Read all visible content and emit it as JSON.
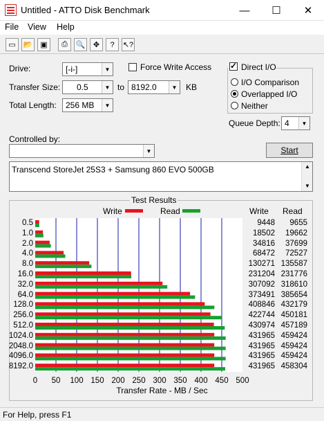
{
  "window": {
    "title": "Untitled - ATTO Disk Benchmark",
    "min": "—",
    "max": "☐",
    "close": "✕"
  },
  "menu": [
    "File",
    "View",
    "Help"
  ],
  "toolbar": [
    "new",
    "open",
    "save",
    "print",
    "print-preview",
    "move",
    "help",
    "context-help"
  ],
  "form": {
    "drive_label": "Drive:",
    "drive_value": "[-i-]",
    "transfer_size_label": "Transfer Size:",
    "ts_from": "0.5",
    "to_label": "to",
    "ts_to": "8192.0",
    "kb_label": "KB",
    "total_length_label": "Total Length:",
    "total_length_value": "256 MB",
    "force_write_label": "Force Write Access",
    "direct_io_label": "Direct I/O",
    "io_comparison_label": "I/O Comparison",
    "overlapped_io_label": "Overlapped I/O",
    "neither_label": "Neither",
    "queue_depth_label": "Queue Depth:",
    "queue_depth_value": "4",
    "controlled_by_label": "Controlled by:",
    "start_label": "Start",
    "description": "Transcend StoreJet 25S3 + Samsung 860 EVO 500GB"
  },
  "results": {
    "title": "Test Results",
    "write_legend": "Write",
    "read_legend": "Read",
    "write_col": "Write",
    "read_col": "Read",
    "xlabel": "Transfer Rate - MB / Sec"
  },
  "colors": {
    "write": "#e8141e",
    "read": "#16a030",
    "grid": "#1a1aa8"
  },
  "chart_data": {
    "type": "bar",
    "orientation": "horizontal",
    "categories": [
      "0.5",
      "1.0",
      "2.0",
      "4.0",
      "8.0",
      "16.0",
      "32.0",
      "64.0",
      "128.0",
      "256.0",
      "512.0",
      "1024.0",
      "2048.0",
      "4096.0",
      "8192.0"
    ],
    "series": [
      {
        "name": "Write",
        "values": [
          9448,
          18502,
          34816,
          68472,
          130271,
          231204,
          307092,
          373491,
          408846,
          422744,
          430974,
          431965,
          431965,
          431965,
          431965
        ]
      },
      {
        "name": "Read",
        "values": [
          9655,
          19662,
          37699,
          72527,
          135587,
          231776,
          318610,
          385654,
          432179,
          450181,
          457189,
          459424,
          459424,
          459424,
          458304
        ]
      }
    ],
    "xticks": [
      "0",
      "50",
      "100",
      "150",
      "200",
      "250",
      "300",
      "350",
      "400",
      "450",
      "500"
    ],
    "xlim": [
      0,
      500
    ],
    "xlabel": "Transfer Rate - MB / Sec",
    "grid": true,
    "legend": "top"
  },
  "status": "For Help, press F1"
}
